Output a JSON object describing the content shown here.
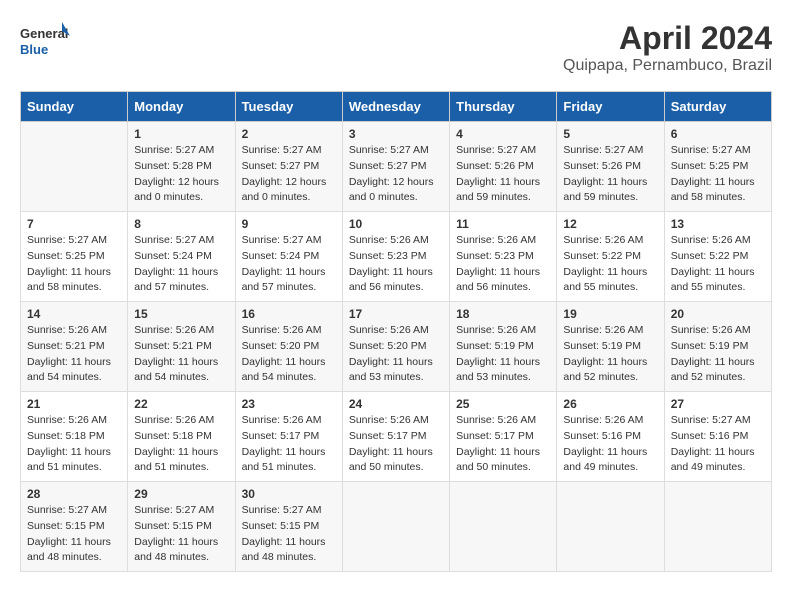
{
  "header": {
    "logo_line1": "General",
    "logo_line2": "Blue",
    "month_title": "April 2024",
    "location": "Quipapa, Pernambuco, Brazil"
  },
  "weekdays": [
    "Sunday",
    "Monday",
    "Tuesday",
    "Wednesday",
    "Thursday",
    "Friday",
    "Saturday"
  ],
  "weeks": [
    [
      {
        "day": "",
        "info": ""
      },
      {
        "day": "1",
        "info": "Sunrise: 5:27 AM\nSunset: 5:28 PM\nDaylight: 12 hours\nand 0 minutes."
      },
      {
        "day": "2",
        "info": "Sunrise: 5:27 AM\nSunset: 5:27 PM\nDaylight: 12 hours\nand 0 minutes."
      },
      {
        "day": "3",
        "info": "Sunrise: 5:27 AM\nSunset: 5:27 PM\nDaylight: 12 hours\nand 0 minutes."
      },
      {
        "day": "4",
        "info": "Sunrise: 5:27 AM\nSunset: 5:26 PM\nDaylight: 11 hours\nand 59 minutes."
      },
      {
        "day": "5",
        "info": "Sunrise: 5:27 AM\nSunset: 5:26 PM\nDaylight: 11 hours\nand 59 minutes."
      },
      {
        "day": "6",
        "info": "Sunrise: 5:27 AM\nSunset: 5:25 PM\nDaylight: 11 hours\nand 58 minutes."
      }
    ],
    [
      {
        "day": "7",
        "info": "Sunrise: 5:27 AM\nSunset: 5:25 PM\nDaylight: 11 hours\nand 58 minutes."
      },
      {
        "day": "8",
        "info": "Sunrise: 5:27 AM\nSunset: 5:24 PM\nDaylight: 11 hours\nand 57 minutes."
      },
      {
        "day": "9",
        "info": "Sunrise: 5:27 AM\nSunset: 5:24 PM\nDaylight: 11 hours\nand 57 minutes."
      },
      {
        "day": "10",
        "info": "Sunrise: 5:26 AM\nSunset: 5:23 PM\nDaylight: 11 hours\nand 56 minutes."
      },
      {
        "day": "11",
        "info": "Sunrise: 5:26 AM\nSunset: 5:23 PM\nDaylight: 11 hours\nand 56 minutes."
      },
      {
        "day": "12",
        "info": "Sunrise: 5:26 AM\nSunset: 5:22 PM\nDaylight: 11 hours\nand 55 minutes."
      },
      {
        "day": "13",
        "info": "Sunrise: 5:26 AM\nSunset: 5:22 PM\nDaylight: 11 hours\nand 55 minutes."
      }
    ],
    [
      {
        "day": "14",
        "info": "Sunrise: 5:26 AM\nSunset: 5:21 PM\nDaylight: 11 hours\nand 54 minutes."
      },
      {
        "day": "15",
        "info": "Sunrise: 5:26 AM\nSunset: 5:21 PM\nDaylight: 11 hours\nand 54 minutes."
      },
      {
        "day": "16",
        "info": "Sunrise: 5:26 AM\nSunset: 5:20 PM\nDaylight: 11 hours\nand 54 minutes."
      },
      {
        "day": "17",
        "info": "Sunrise: 5:26 AM\nSunset: 5:20 PM\nDaylight: 11 hours\nand 53 minutes."
      },
      {
        "day": "18",
        "info": "Sunrise: 5:26 AM\nSunset: 5:19 PM\nDaylight: 11 hours\nand 53 minutes."
      },
      {
        "day": "19",
        "info": "Sunrise: 5:26 AM\nSunset: 5:19 PM\nDaylight: 11 hours\nand 52 minutes."
      },
      {
        "day": "20",
        "info": "Sunrise: 5:26 AM\nSunset: 5:19 PM\nDaylight: 11 hours\nand 52 minutes."
      }
    ],
    [
      {
        "day": "21",
        "info": "Sunrise: 5:26 AM\nSunset: 5:18 PM\nDaylight: 11 hours\nand 51 minutes."
      },
      {
        "day": "22",
        "info": "Sunrise: 5:26 AM\nSunset: 5:18 PM\nDaylight: 11 hours\nand 51 minutes."
      },
      {
        "day": "23",
        "info": "Sunrise: 5:26 AM\nSunset: 5:17 PM\nDaylight: 11 hours\nand 51 minutes."
      },
      {
        "day": "24",
        "info": "Sunrise: 5:26 AM\nSunset: 5:17 PM\nDaylight: 11 hours\nand 50 minutes."
      },
      {
        "day": "25",
        "info": "Sunrise: 5:26 AM\nSunset: 5:17 PM\nDaylight: 11 hours\nand 50 minutes."
      },
      {
        "day": "26",
        "info": "Sunrise: 5:26 AM\nSunset: 5:16 PM\nDaylight: 11 hours\nand 49 minutes."
      },
      {
        "day": "27",
        "info": "Sunrise: 5:27 AM\nSunset: 5:16 PM\nDaylight: 11 hours\nand 49 minutes."
      }
    ],
    [
      {
        "day": "28",
        "info": "Sunrise: 5:27 AM\nSunset: 5:15 PM\nDaylight: 11 hours\nand 48 minutes."
      },
      {
        "day": "29",
        "info": "Sunrise: 5:27 AM\nSunset: 5:15 PM\nDaylight: 11 hours\nand 48 minutes."
      },
      {
        "day": "30",
        "info": "Sunrise: 5:27 AM\nSunset: 5:15 PM\nDaylight: 11 hours\nand 48 minutes."
      },
      {
        "day": "",
        "info": ""
      },
      {
        "day": "",
        "info": ""
      },
      {
        "day": "",
        "info": ""
      },
      {
        "day": "",
        "info": ""
      }
    ]
  ]
}
